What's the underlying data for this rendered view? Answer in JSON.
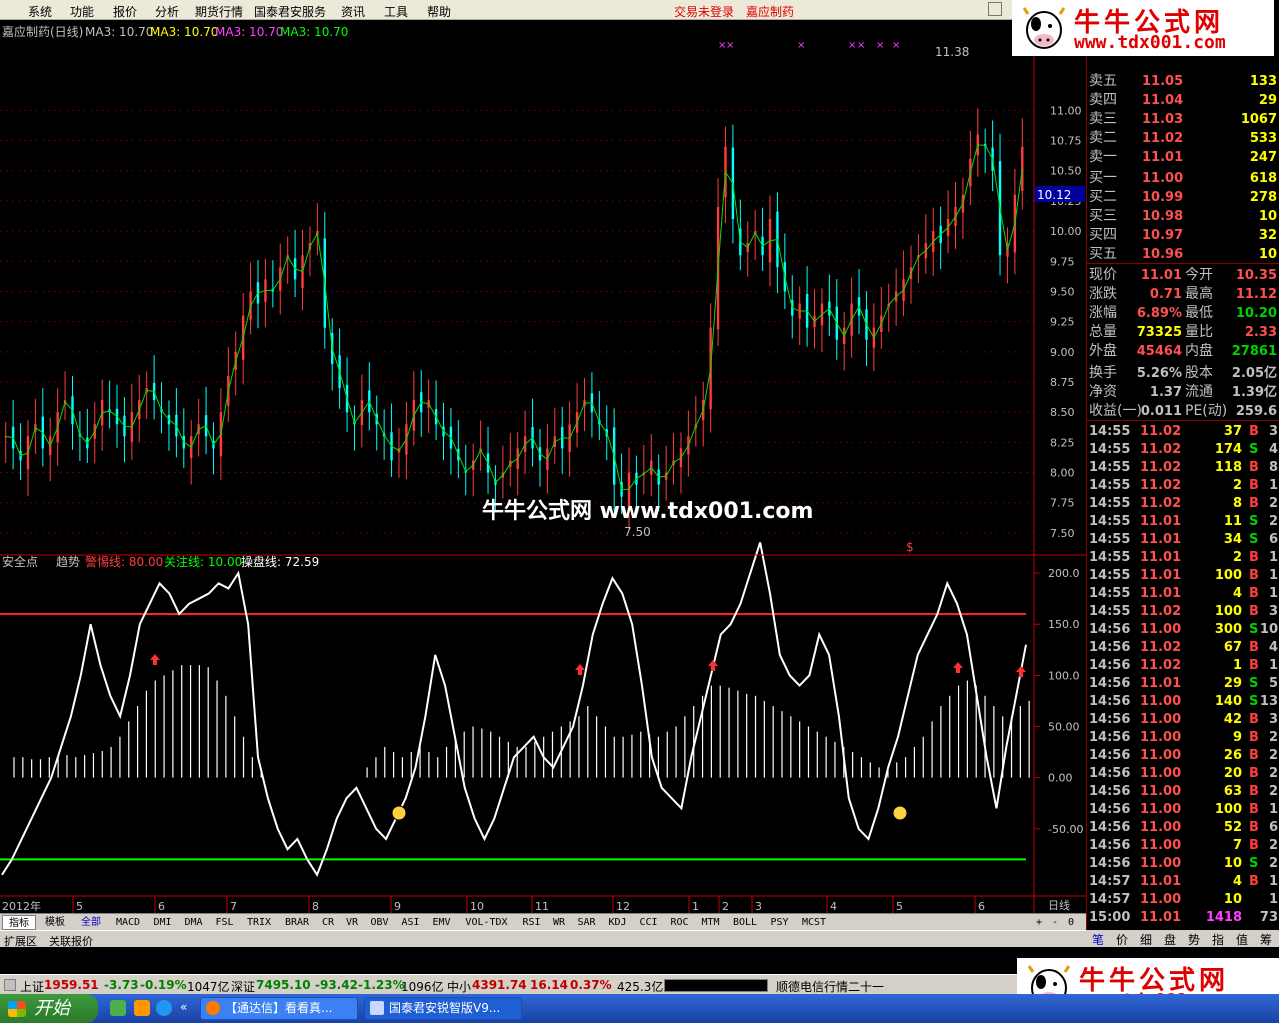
{
  "menu": {
    "items": [
      "系统",
      "功能",
      "报价",
      "分析",
      "期货行情",
      "国泰君安服务",
      "资讯",
      "工具",
      "帮助"
    ],
    "status": "交易未登录",
    "stock_name": "嘉应制药"
  },
  "logo": {
    "title": "牛牛公式网",
    "url": "www.tdx001.com"
  },
  "watermark": "牛牛公式网 www.tdx001.com",
  "colors": {
    "up": "#ff3c3c",
    "down": "#00d000",
    "ma": "#ffff00",
    "white": "#ffffff",
    "axis": "#c00000"
  },
  "main_header": {
    "title": "嘉应制药(日线)",
    "ma1": "MA3: 10.70",
    "ma2": "MA3: 10.70",
    "ma3": "MA3: 10.70",
    "ma4": "MA3: 10.70"
  },
  "price_axis": {
    "labels": [
      "11.00",
      "10.75",
      "10.50",
      "10.25",
      "10.00",
      "9.75",
      "9.50",
      "9.25",
      "9.00",
      "8.75",
      "8.50",
      "8.25",
      "8.00",
      "7.75",
      "7.50"
    ],
    "current": "10.12"
  },
  "annotations": {
    "high": "11.38",
    "low": "7.50"
  },
  "indicator_header": {
    "name": "安全点",
    "trend": "趋势",
    "warn": "警惕线: 80.00",
    "focus": "关注线: 10.00",
    "op": "操盘线: 72.59"
  },
  "ind_axis": {
    "labels": [
      "200.0",
      "150.0",
      "100.0",
      "50.00",
      "0.00",
      "-50.00"
    ]
  },
  "time_axis": {
    "year": "2012年",
    "months": [
      "5",
      "6",
      "7",
      "8",
      "9",
      "10",
      "11",
      "12",
      "1",
      "2",
      "3",
      "4",
      "5",
      "6"
    ],
    "period": "日线"
  },
  "chart_data": {
    "type": "candlestick",
    "ylim": [
      7.4,
      11.5
    ],
    "indicator_ylim": [
      -105,
      205
    ],
    "warn_line": 160,
    "focus_line": -80,
    "closes": [
      8.3,
      8.2,
      8.1,
      8.3,
      8.4,
      8.2,
      8.3,
      8.5,
      8.6,
      8.4,
      8.3,
      8.2,
      8.4,
      8.6,
      8.5,
      8.4,
      8.3,
      8.5,
      8.6,
      8.7,
      8.6,
      8.5,
      8.4,
      8.3,
      8.2,
      8.3,
      8.4,
      8.3,
      8.2,
      8.5,
      8.8,
      9.0,
      9.3,
      9.5,
      9.4,
      9.6,
      9.5,
      9.7,
      9.8,
      9.6,
      9.8,
      9.9,
      10.0,
      9.2,
      8.9,
      8.7,
      8.5,
      8.4,
      8.6,
      8.5,
      8.4,
      8.3,
      8.1,
      8.2,
      8.4,
      8.6,
      8.5,
      8.6,
      8.4,
      8.3,
      8.2,
      8.1,
      8.0,
      8.1,
      8.2,
      8.0,
      7.9,
      8.0,
      8.1,
      8.2,
      8.3,
      8.2,
      8.1,
      8.2,
      8.3,
      8.2,
      8.4,
      8.5,
      8.6,
      8.5,
      8.4,
      8.3,
      7.9,
      7.8,
      8.0,
      7.9,
      8.0,
      8.1,
      7.9,
      8.0,
      8.1,
      8.2,
      8.3,
      8.4,
      8.6,
      9.2,
      10.2,
      10.7,
      10.1,
      9.8,
      9.9,
      10.0,
      9.8,
      10.1,
      9.7,
      9.5,
      9.3,
      9.4,
      9.2,
      9.3,
      9.4,
      9.3,
      9.1,
      9.2,
      9.4,
      9.3,
      9.1,
      9.2,
      9.3,
      9.4,
      9.5,
      9.6,
      9.7,
      9.8,
      9.9,
      10.0,
      9.9,
      10.1,
      10.2,
      10.3,
      10.6,
      10.8,
      10.7,
      10.5,
      9.8,
      9.9,
      10.3,
      10.7
    ],
    "indicator": [
      -95,
      -80,
      -60,
      -40,
      -20,
      0,
      30,
      60,
      100,
      150,
      110,
      80,
      60,
      100,
      150,
      170,
      190,
      180,
      160,
      170,
      175,
      180,
      190,
      185,
      200,
      150,
      20,
      -20,
      -50,
      -70,
      -60,
      -80,
      -95,
      -70,
      -40,
      -20,
      -10,
      -30,
      -50,
      -60,
      -40,
      -20,
      10,
      60,
      120,
      90,
      40,
      -10,
      -40,
      -60,
      -40,
      -10,
      20,
      30,
      40,
      20,
      10,
      30,
      50,
      90,
      140,
      170,
      195,
      180,
      150,
      90,
      20,
      -10,
      -20,
      -30,
      20,
      60,
      100,
      140,
      150,
      170,
      200,
      230,
      180,
      120,
      100,
      90,
      100,
      140,
      120,
      60,
      -20,
      -50,
      -60,
      -30,
      10,
      40,
      80,
      120,
      140,
      160,
      190,
      170,
      140,
      80,
      20,
      -30,
      30,
      80,
      130
    ],
    "histogram": [
      20,
      20,
      18,
      18,
      20,
      20,
      22,
      20,
      22,
      24,
      26,
      30,
      40,
      55,
      70,
      85,
      95,
      100,
      105,
      110,
      110,
      110,
      108,
      95,
      80,
      60,
      40,
      20,
      5,
      0,
      0,
      0,
      0,
      0,
      0,
      0,
      0,
      0,
      0,
      0,
      10,
      20,
      30,
      25,
      20,
      25,
      30,
      25,
      20,
      30,
      40,
      45,
      50,
      48,
      45,
      40,
      35,
      30,
      30,
      35,
      40,
      45,
      50,
      55,
      60,
      70,
      60,
      50,
      40,
      40,
      42,
      45,
      42,
      40,
      45,
      50,
      60,
      70,
      80,
      90,
      90,
      88,
      85,
      82,
      80,
      75,
      70,
      65,
      60,
      55,
      50,
      45,
      40,
      35,
      30,
      25,
      20,
      15,
      10,
      10,
      15,
      20,
      30,
      40,
      55,
      70,
      80,
      90,
      95,
      90,
      80,
      70,
      60,
      60,
      70,
      75
    ]
  },
  "quote": {
    "book": [
      {
        "label": "卖五",
        "price": "11.05",
        "vol": "133"
      },
      {
        "label": "卖四",
        "price": "11.04",
        "vol": "29"
      },
      {
        "label": "卖三",
        "price": "11.03",
        "vol": "1067"
      },
      {
        "label": "卖二",
        "price": "11.02",
        "vol": "533"
      },
      {
        "label": "卖一",
        "price": "11.01",
        "vol": "247"
      },
      {
        "label": "买一",
        "price": "11.00",
        "vol": "618"
      },
      {
        "label": "买二",
        "price": "10.99",
        "vol": "278"
      },
      {
        "label": "买三",
        "price": "10.98",
        "vol": "10"
      },
      {
        "label": "买四",
        "price": "10.97",
        "vol": "32"
      },
      {
        "label": "买五",
        "price": "10.96",
        "vol": "10"
      }
    ],
    "stats": [
      {
        "l1": "现价",
        "v1": "11.01",
        "l2": "今开",
        "v2": "10.35"
      },
      {
        "l1": "涨跌",
        "v1": "0.71",
        "l2": "最高",
        "v2": "11.12"
      },
      {
        "l1": "涨幅",
        "v1": "6.89%",
        "l2": "最低",
        "v2": "10.20"
      },
      {
        "l1": "总量",
        "v1": "73325",
        "l2": "量比",
        "v2": "2.33"
      },
      {
        "l1": "外盘",
        "v1": "45464",
        "l2": "内盘",
        "v2": "27861"
      },
      {
        "l1": "换手",
        "v1": "5.26%",
        "l2": "股本",
        "v2": "2.05亿"
      },
      {
        "l1": "净资",
        "v1": "1.37",
        "l2": "流通",
        "v2": "1.39亿"
      },
      {
        "l1": "收益(一)",
        "v1": "0.011",
        "l2": "PE(动)",
        "v2": "259.6"
      }
    ],
    "ticks": [
      {
        "t": "14:55",
        "p": "11.02",
        "v": "37",
        "s": "B",
        "n": "3"
      },
      {
        "t": "14:55",
        "p": "11.02",
        "v": "174",
        "s": "S",
        "n": "4"
      },
      {
        "t": "14:55",
        "p": "11.02",
        "v": "118",
        "s": "B",
        "n": "8"
      },
      {
        "t": "14:55",
        "p": "11.02",
        "v": "2",
        "s": "B",
        "n": "1"
      },
      {
        "t": "14:55",
        "p": "11.02",
        "v": "8",
        "s": "B",
        "n": "2"
      },
      {
        "t": "14:55",
        "p": "11.01",
        "v": "11",
        "s": "S",
        "n": "2"
      },
      {
        "t": "14:55",
        "p": "11.01",
        "v": "34",
        "s": "S",
        "n": "6"
      },
      {
        "t": "14:55",
        "p": "11.01",
        "v": "2",
        "s": "B",
        "n": "1"
      },
      {
        "t": "14:55",
        "p": "11.01",
        "v": "100",
        "s": "B",
        "n": "1"
      },
      {
        "t": "14:55",
        "p": "11.01",
        "v": "4",
        "s": "B",
        "n": "1"
      },
      {
        "t": "14:55",
        "p": "11.02",
        "v": "100",
        "s": "B",
        "n": "3"
      },
      {
        "t": "14:56",
        "p": "11.00",
        "v": "300",
        "s": "S",
        "n": "10"
      },
      {
        "t": "14:56",
        "p": "11.02",
        "v": "67",
        "s": "B",
        "n": "4"
      },
      {
        "t": "14:56",
        "p": "11.02",
        "v": "1",
        "s": "B",
        "n": "1"
      },
      {
        "t": "14:56",
        "p": "11.01",
        "v": "29",
        "s": "S",
        "n": "5"
      },
      {
        "t": "14:56",
        "p": "11.00",
        "v": "140",
        "s": "S",
        "n": "13"
      },
      {
        "t": "14:56",
        "p": "11.00",
        "v": "42",
        "s": "B",
        "n": "3"
      },
      {
        "t": "14:56",
        "p": "11.00",
        "v": "9",
        "s": "B",
        "n": "2"
      },
      {
        "t": "14:56",
        "p": "11.00",
        "v": "26",
        "s": "B",
        "n": "2"
      },
      {
        "t": "14:56",
        "p": "11.00",
        "v": "20",
        "s": "B",
        "n": "2"
      },
      {
        "t": "14:56",
        "p": "11.00",
        "v": "63",
        "s": "B",
        "n": "2"
      },
      {
        "t": "14:56",
        "p": "11.00",
        "v": "100",
        "s": "B",
        "n": "1"
      },
      {
        "t": "14:56",
        "p": "11.00",
        "v": "52",
        "s": "B",
        "n": "6"
      },
      {
        "t": "14:56",
        "p": "11.00",
        "v": "7",
        "s": "B",
        "n": "2"
      },
      {
        "t": "14:56",
        "p": "11.00",
        "v": "10",
        "s": "S",
        "n": "2"
      },
      {
        "t": "14:57",
        "p": "11.01",
        "v": "4",
        "s": "B",
        "n": "1"
      },
      {
        "t": "14:57",
        "p": "11.00",
        "v": "10",
        "s": "",
        "n": "1"
      },
      {
        "t": "15:00",
        "p": "11.01",
        "v": "1418",
        "s": "",
        "n": "73"
      }
    ],
    "tabs": [
      "笔",
      "价",
      "细",
      "盘",
      "势",
      "指",
      "值",
      "筹"
    ]
  },
  "tabs": [
    "指标",
    "模板",
    "全部",
    "MACD",
    "DMI",
    "DMA",
    "FSL",
    "TRIX",
    "BRAR",
    "CR",
    "VR",
    "OBV",
    "ASI",
    "EMV",
    "VOL-TDX",
    "RSI",
    "WR",
    "SAR",
    "KDJ",
    "CCI",
    "ROC",
    "MTM",
    "BOLL",
    "PSY",
    "MCST"
  ],
  "ext_tabs": [
    "扩展区",
    "关联报价"
  ],
  "statusbar": {
    "sh_label": "上证",
    "sh": "1959.51",
    "sh_chg": "-3.73",
    "sh_pct": "-0.19%",
    "sh_amt": "1047亿",
    "sz_label": "深证",
    "sz": "7495.10",
    "sz_chg": "-93.42",
    "sz_pct": "-1.23%",
    "sz_amt": "1096亿",
    "zx_label": "中小",
    "zx": "4391.74",
    "zx_chg": "16.14",
    "zx_pct": "0.37%",
    "zx_amt": "425.3亿",
    "ticker": "顺德电信行情二十一"
  },
  "taskbar": {
    "start": "开始",
    "task1": "【通达信】看看真...",
    "task2": "国泰君安锐智版V9..."
  }
}
